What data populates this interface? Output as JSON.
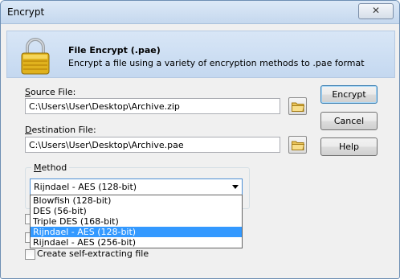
{
  "window": {
    "title": "Encrypt",
    "close_glyph": "✕"
  },
  "header": {
    "title": "File Encrypt (.pae)",
    "description": "Encrypt a file using a variety of encryption methods to .pae format"
  },
  "source": {
    "label_accel": "S",
    "label_rest": "ource File:",
    "value": "C:\\Users\\User\\Desktop\\Archive.zip"
  },
  "destination": {
    "label_accel": "D",
    "label_rest": "estination File:",
    "value": "C:\\Users\\User\\Desktop\\Archive.pae"
  },
  "buttons": {
    "encrypt": "Encrypt",
    "cancel": "Cancel",
    "help": "Help"
  },
  "method": {
    "label_accel": "M",
    "label_rest": "ethod",
    "selected": "Rijndael - AES (128-bit)",
    "options": [
      "Blowfish (128-bit)",
      "DES (56-bit)",
      "Triple DES (168-bit)",
      "Rijndael - AES (128-bit)",
      "Rijndael - AES (256-bit)"
    ],
    "selected_index": 3
  },
  "self_extract": {
    "label": "Create self-extracting file",
    "checked": false
  },
  "colors": {
    "selection": "#3399ff",
    "header_bg": "#c9dbf2"
  }
}
